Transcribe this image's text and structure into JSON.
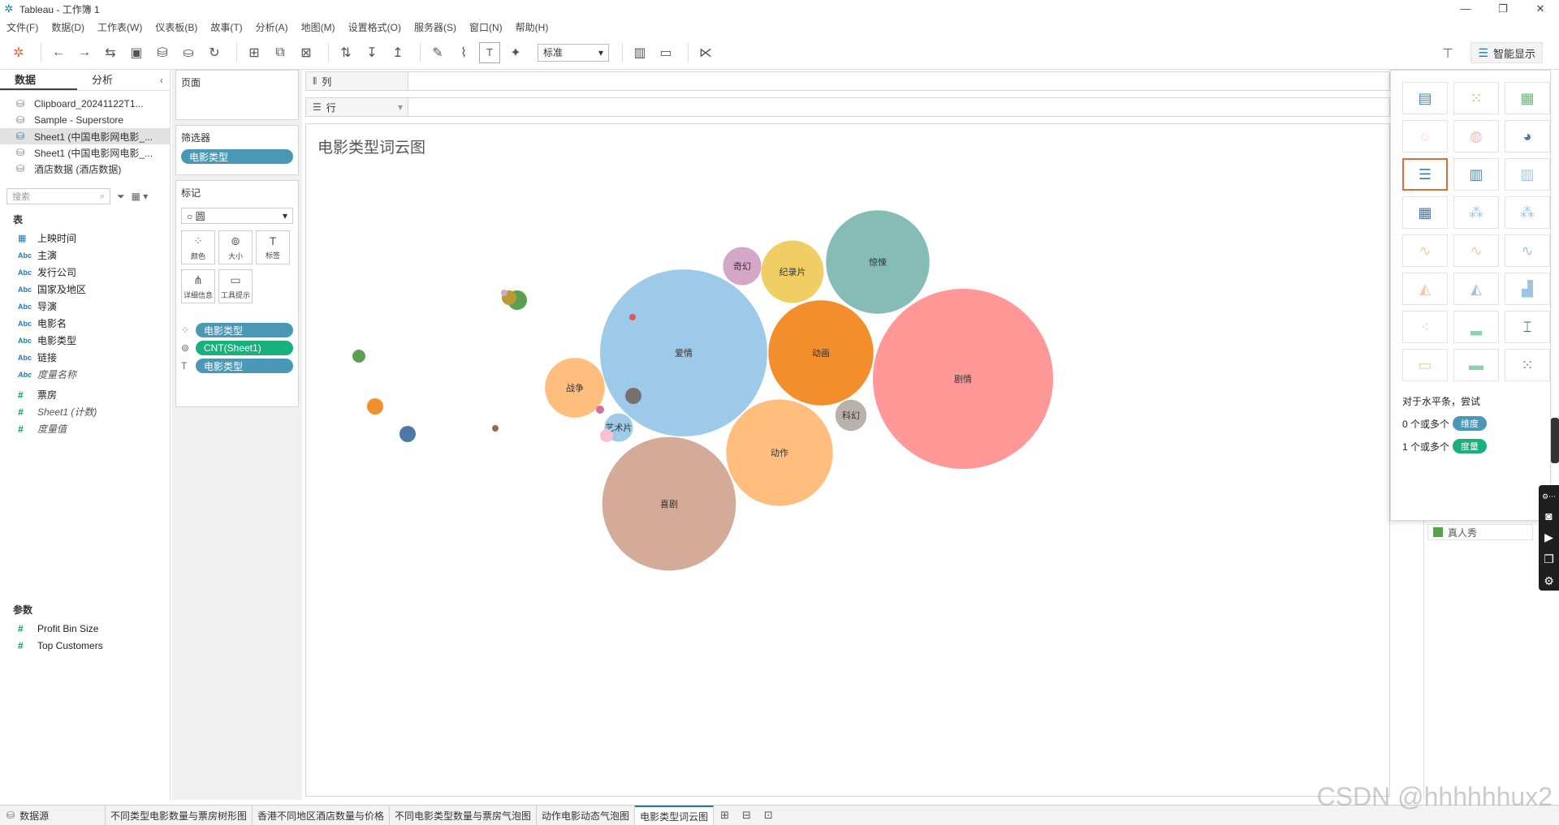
{
  "window": {
    "title": "Tableau - 工作簿 1",
    "app_icon": "tableau-logo-icon"
  },
  "menu": [
    "文件(F)",
    "数据(D)",
    "工作表(W)",
    "仪表板(B)",
    "故事(T)",
    "分析(A)",
    "地图(M)",
    "设置格式(O)",
    "服务器(S)",
    "窗口(N)",
    "帮助(H)"
  ],
  "toolbar": {
    "fit_select": "标准",
    "smart_show_label": "智能显示"
  },
  "left_pane": {
    "tabs": [
      "数据",
      "分析"
    ],
    "datasources": [
      "Clipboard_20241122T1...",
      "Sample - Superstore",
      "Sheet1 (中国电影网电影_...",
      "Sheet1 (中国电影网电影_...",
      "酒店数据 (酒店数据)"
    ],
    "search_placeholder": "搜索",
    "tables_label": "表",
    "fields": [
      {
        "type": "日",
        "name": "上映时间"
      },
      {
        "type": "Abc",
        "name": "主演"
      },
      {
        "type": "Abc",
        "name": "发行公司"
      },
      {
        "type": "Abc",
        "name": "国家及地区"
      },
      {
        "type": "Abc",
        "name": "导演"
      },
      {
        "type": "Abc",
        "name": "电影名"
      },
      {
        "type": "Abc",
        "name": "电影类型"
      },
      {
        "type": "Abc",
        "name": "链接"
      },
      {
        "type": "Abc",
        "name": "度量名称"
      },
      {
        "type": "#",
        "name": "票房"
      },
      {
        "type": "#",
        "name": "Sheet1 (计数)"
      },
      {
        "type": "#",
        "name": "度量值"
      }
    ],
    "params_label": "参数",
    "params": [
      "Profit Bin Size",
      "Top Customers"
    ]
  },
  "shelves": {
    "pages_label": "页面",
    "filters_label": "筛选器",
    "filter_pill": "电影类型",
    "marks_label": "标记",
    "mark_type": "圆",
    "mark_buttons": [
      "颜色",
      "大小",
      "标签",
      "详细信息",
      "工具提示"
    ],
    "mark_pills": [
      "电影类型",
      "CNT(Sheet1)",
      "电影类型"
    ],
    "columns_label": "列",
    "rows_label": "行"
  },
  "view": {
    "title": "电影类型词云图"
  },
  "chart_data": {
    "type": "bubble",
    "title": "电影类型词云图",
    "series": [
      {
        "name": "剧情",
        "value": 100,
        "color": "#ff9896"
      },
      {
        "name": "爱情",
        "value": 86,
        "color": "#9ecae9"
      },
      {
        "name": "喜剧",
        "value": 55,
        "color": "#d4aa99"
      },
      {
        "name": "动画",
        "value": 34,
        "color": "#f28e2b"
      },
      {
        "name": "动作",
        "value": 35,
        "color": "#ffbe7d"
      },
      {
        "name": "惊悚",
        "value": 33,
        "color": "#86bcb6"
      },
      {
        "name": "纪录片",
        "value": 12,
        "color": "#f1ce63"
      },
      {
        "name": "战争",
        "value": 11,
        "color": "#ffbe7d"
      },
      {
        "name": "奇幻",
        "value": 4.5,
        "color": "#d4a6c8"
      },
      {
        "name": "科幻",
        "value": 3,
        "color": "#bab0ac"
      },
      {
        "name": "艺术片",
        "value": 2.5,
        "color": "#a0cbe8"
      }
    ]
  },
  "smart_panel": {
    "hint_title": "对于水平条，尝试",
    "hint_dim": "0 个或多个",
    "hint_dim_badge": "维度",
    "hint_mea": "1 个或多个",
    "hint_mea_badge": "度量"
  },
  "legend": {
    "item": "真人秀",
    "color": "#59a14f"
  },
  "bottom_tabs": {
    "datasource": "数据源",
    "sheets": [
      "不同类型电影数量与票房树形图",
      "香港不同地区酒店数量与价格",
      "不同电影类型数量与票房气泡图",
      "动作电影动态气泡图",
      "电影类型词云图"
    ]
  },
  "watermark": "CSDN @hhhhhhux2"
}
